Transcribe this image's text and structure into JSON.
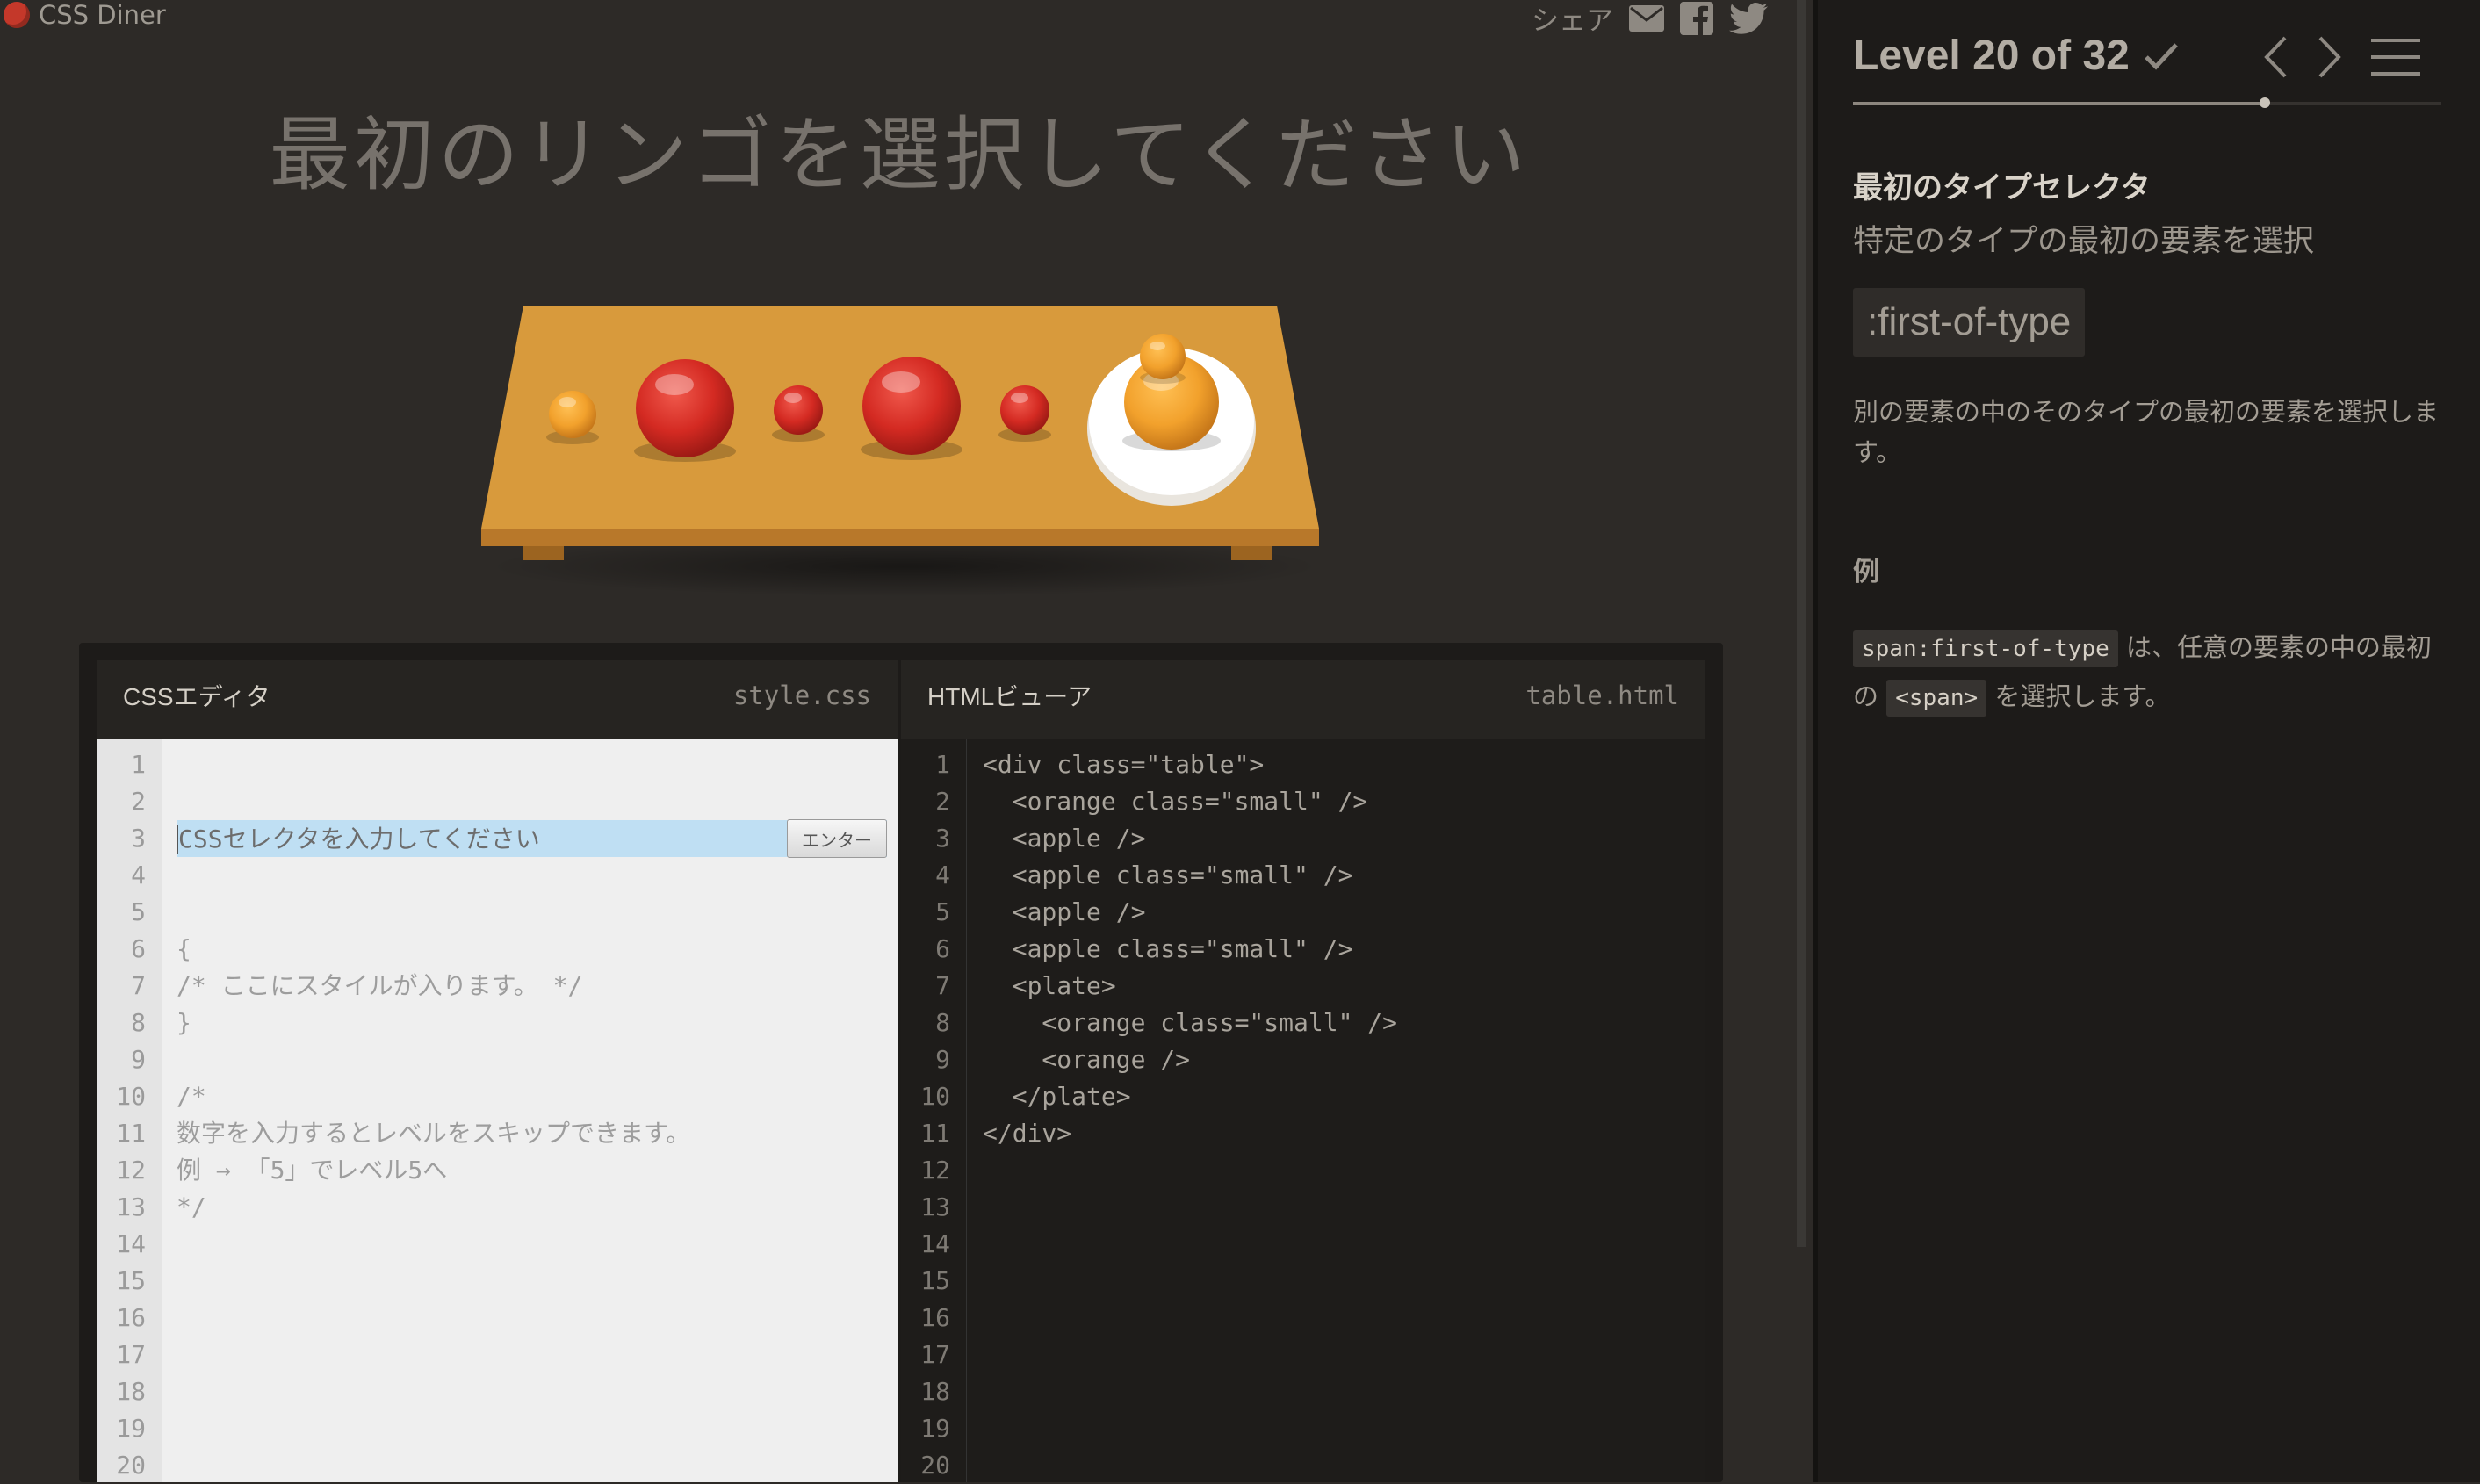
{
  "app": {
    "title": "CSS Diner"
  },
  "share": {
    "label": "シェア"
  },
  "instruction": "最初のリンゴを選択してください",
  "board": {
    "items": [
      "orange small",
      "apple",
      "apple small",
      "apple",
      "apple small",
      "plate with orange small and orange"
    ]
  },
  "css_editor": {
    "title": "CSSエディタ",
    "filename": "style.css",
    "placeholder": "CSSセレクタを入力してください",
    "enter_label": "エンター",
    "lines": [
      "{",
      "/* ここにスタイルが入ります。 */",
      "}",
      "",
      "/*",
      "数字を入力するとレベルをスキップできます。",
      "例 → 「5」でレベル5へ",
      "*/"
    ],
    "line_numbers": [
      "1",
      "2",
      "3",
      "4",
      "5",
      "6",
      "7",
      "8",
      "9",
      "10",
      "11",
      "12",
      "13",
      "14",
      "15",
      "16",
      "17",
      "18",
      "19",
      "20"
    ]
  },
  "html_viewer": {
    "title": "HTMLビューア",
    "filename": "table.html",
    "code": "<div class=\"table\">\n  <orange class=\"small\" />\n  <apple />\n  <apple class=\"small\" />\n  <apple />\n  <apple class=\"small\" />\n  <plate>\n    <orange class=\"small\" />\n    <orange />\n  </plate>\n</div>",
    "line_numbers": [
      "1",
      "2",
      "3",
      "4",
      "5",
      "6",
      "7",
      "8",
      "9",
      "10",
      "11",
      "12",
      "13",
      "14",
      "15",
      "16",
      "17",
      "18",
      "19",
      "20"
    ]
  },
  "sidebar": {
    "level_label": "Level 20 of 32",
    "progress": 0.7,
    "selector_name": "最初のタイプセレクタ",
    "selector_title": "特定のタイプの最初の要素を選択",
    "syntax": ":first-of-type",
    "hint": "別の要素の中のそのタイプの最初の要素を選択します。",
    "examples_title": "例",
    "example": {
      "code": "span:first-of-type",
      "text1": " は、任意の要素の中の最初の ",
      "code2": "<span>",
      "text2": " を選択します。"
    }
  },
  "colors": {
    "apple": "#d42a22",
    "orange": "#f2a12c",
    "table": "#d89a3c",
    "plate": "#ffffff"
  }
}
